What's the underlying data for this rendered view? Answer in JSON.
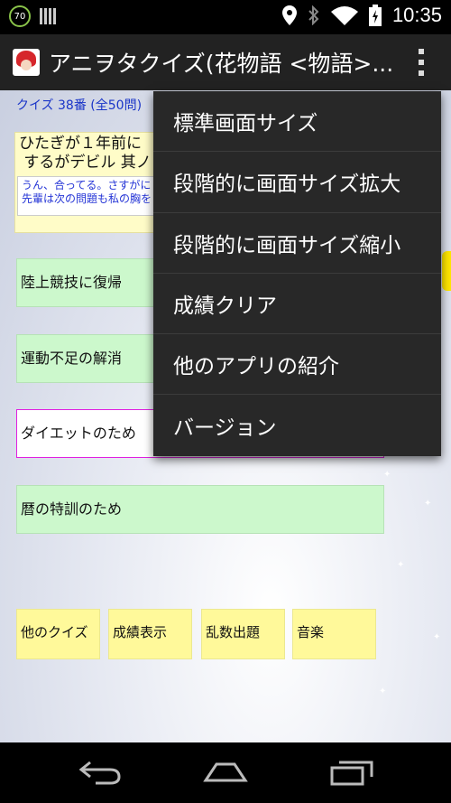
{
  "status_bar": {
    "battery_level": "70",
    "time": "10:35"
  },
  "action_bar": {
    "title": "アニヲタクイズ(花物語 <物語>..."
  },
  "quiz": {
    "label": "クイズ 38番 (全50問)",
    "question": "ひたぎが１年前に\n するがデビル 其ノ",
    "answer_feedback": "うん、合ってる。さすがに\n先輩は次の問題も私の胸を"
  },
  "choices": [
    {
      "label": "陸上競技に復帰"
    },
    {
      "label": "運動不足の解消"
    },
    {
      "label": "ダイエットのため"
    },
    {
      "label": "暦の特訓のため"
    }
  ],
  "bottom_buttons": [
    {
      "label": "他のクイズ"
    },
    {
      "label": "成績表示"
    },
    {
      "label": "乱数出題"
    },
    {
      "label": "音楽"
    }
  ],
  "menu": {
    "items": [
      {
        "label": "標準画面サイズ"
      },
      {
        "label": "段階的に画面サイズ拡大"
      },
      {
        "label": "段階的に画面サイズ縮小"
      },
      {
        "label": "成績クリア"
      },
      {
        "label": "他のアプリの紹介"
      },
      {
        "label": "バージョン"
      }
    ]
  },
  "nav_bar": {
    "icons": [
      "back-icon",
      "home-icon",
      "recents-icon"
    ]
  },
  "colors": {
    "quiz_label": "#1a35c8",
    "question_bg": "#fffcc8",
    "choice_bg": "#ccf8cc",
    "selected_border": "#e020e0",
    "bottom_button_bg": "#fff99a",
    "menu_bg": "#282828"
  }
}
